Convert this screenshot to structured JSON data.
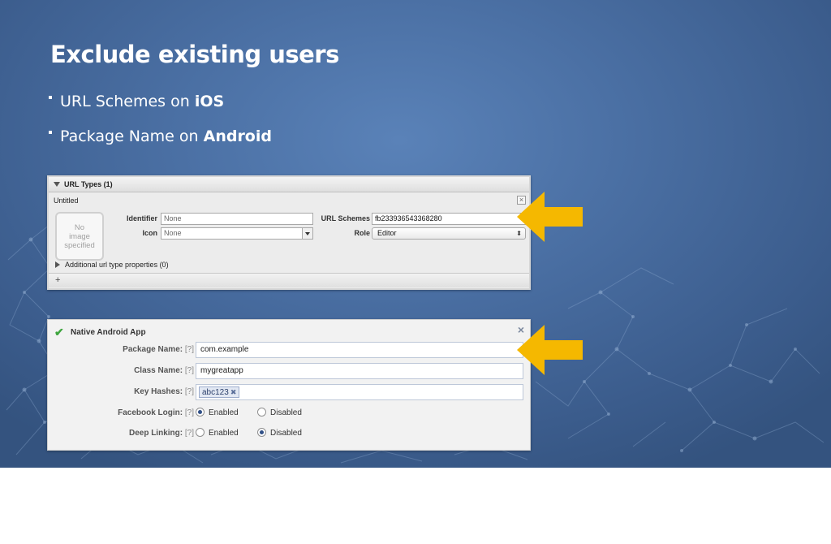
{
  "slide": {
    "title": "Exclude existing users",
    "bullets": [
      {
        "prefix": "URL Schemes on ",
        "bold": "iOS"
      },
      {
        "prefix": "Package Name on ",
        "bold": "Android"
      }
    ]
  },
  "xcode_panel": {
    "header": "URL Types (1)",
    "item_title": "Untitled",
    "no_image_lines": [
      "No",
      "image",
      "specified"
    ],
    "identifier_label": "Identifier",
    "identifier_value": "None",
    "icon_label": "Icon",
    "icon_value": "None",
    "url_schemes_label": "URL Schemes",
    "url_schemes_value": "fb233936543368280",
    "role_label": "Role",
    "role_value": "Editor",
    "additional": "Additional url type properties (0)",
    "add_symbol": "+",
    "close_symbol": "×"
  },
  "android_panel": {
    "title": "Native Android App",
    "close_symbol": "×",
    "help": "[?]",
    "package_name_label": "Package Name:",
    "package_name_value": "com.example",
    "class_name_label": "Class Name:",
    "class_name_value": "mygreatapp",
    "key_hashes_label": "Key Hashes:",
    "key_hash_token": "abc123",
    "facebook_login_label": "Facebook Login:",
    "deep_linking_label": "Deep Linking:",
    "enabled_label": "Enabled",
    "disabled_label": "Disabled",
    "facebook_login_selected": "Enabled",
    "deep_linking_selected": "Disabled"
  },
  "colors": {
    "arrow": "#f5b800",
    "slide_bg": "#4a6fa3"
  }
}
